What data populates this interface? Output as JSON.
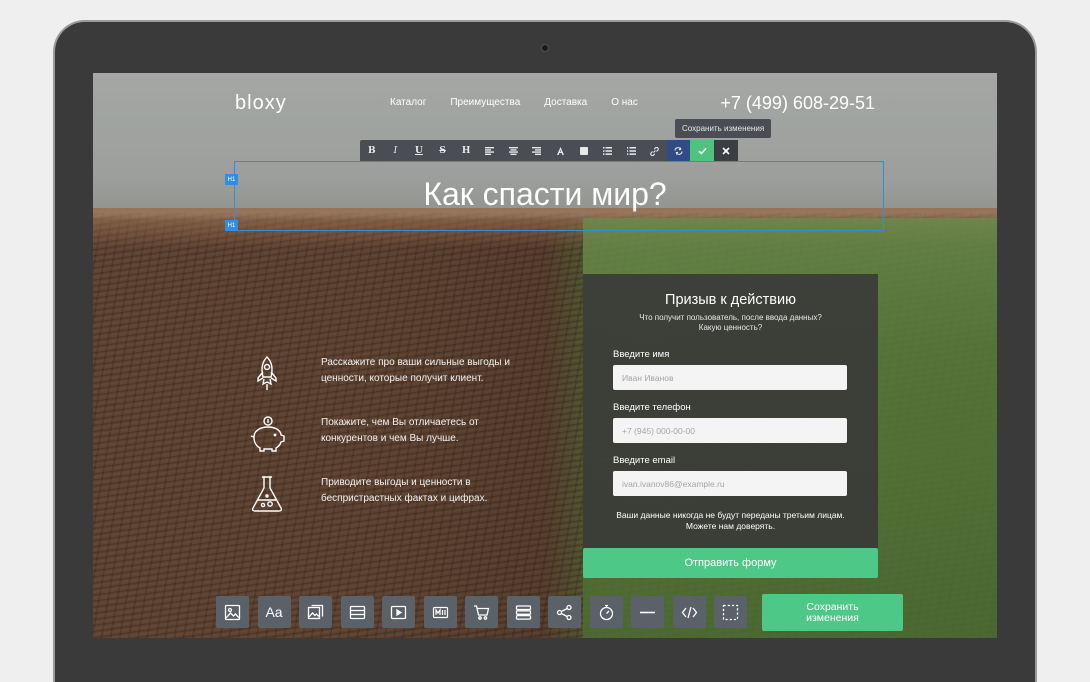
{
  "site": {
    "logo": "bloxy",
    "nav": [
      "Каталог",
      "Преимущества",
      "Доставка",
      "О нас"
    ],
    "phone": "+7 (499) 608-29-51"
  },
  "editor": {
    "tooltip": "Сохранить изменения",
    "toolbar_buttons": [
      {
        "label": "B",
        "icon": "bold-icon"
      },
      {
        "label": "I",
        "icon": "italic-icon"
      },
      {
        "label": "U",
        "icon": "underline-icon"
      },
      {
        "label": "S",
        "icon": "strikethrough-icon"
      },
      {
        "label": "H",
        "icon": "heading-icon"
      },
      {
        "label": "",
        "icon": "align-left-icon"
      },
      {
        "label": "",
        "icon": "align-center-icon"
      },
      {
        "label": "",
        "icon": "align-right-icon"
      },
      {
        "label": "",
        "icon": "text-color-icon"
      },
      {
        "label": "",
        "icon": "background-color-icon"
      },
      {
        "label": "",
        "icon": "bullet-list-icon"
      },
      {
        "label": "",
        "icon": "numbered-list-icon"
      },
      {
        "label": "",
        "icon": "link-icon"
      },
      {
        "label": "",
        "icon": "refresh-icon"
      },
      {
        "label": "",
        "icon": "check-icon"
      },
      {
        "label": "",
        "icon": "close-icon"
      }
    ],
    "heading_tag": "H1"
  },
  "hero": {
    "headline": "Как спасти мир?"
  },
  "benefits": [
    {
      "icon": "rocket-icon",
      "text": "Расскажите про ваши сильные выгоды и ценности, которые получит клиент."
    },
    {
      "icon": "piggy-bank-icon",
      "text": "Покажите, чем Вы отличаетесь от конкурентов и чем Вы лучше."
    },
    {
      "icon": "flask-icon",
      "text": "Приводите выгоды и ценности в беспристрастных фактах и цифрах."
    }
  ],
  "form": {
    "title": "Призыв к действию",
    "subtitle_line1": "Что получит пользователь, после ввода данных?",
    "subtitle_line2": "Какую ценность?",
    "name_label": "Введите имя",
    "name_placeholder": "Иван Иванов",
    "phone_label": "Введите телефон",
    "phone_placeholder": "+7 (945) 000-00-00",
    "email_label": "Введите email",
    "email_placeholder": "ivan.ivanov86@example.ru",
    "privacy_line1": "Ваши данные никогда не будут переданы третьим лицам.",
    "privacy_line2": "Можете нам доверять.",
    "submit": "Отправить форму"
  },
  "blocks_bar": {
    "items": [
      {
        "label": "",
        "icon": "image-icon"
      },
      {
        "label": "Aa",
        "icon": "text-icon"
      },
      {
        "label": "",
        "icon": "gallery-icon"
      },
      {
        "label": "",
        "icon": "layout-icon"
      },
      {
        "label": "",
        "icon": "video-icon"
      },
      {
        "label": "",
        "icon": "timer-icon"
      },
      {
        "label": "",
        "icon": "cart-icon"
      },
      {
        "label": "",
        "icon": "list-icon"
      },
      {
        "label": "",
        "icon": "share-icon"
      },
      {
        "label": "",
        "icon": "stopwatch-icon"
      },
      {
        "label": "",
        "icon": "divider-icon"
      },
      {
        "label": "",
        "icon": "code-icon"
      },
      {
        "label": "",
        "icon": "selection-icon"
      }
    ],
    "save_line1": "Сохранить",
    "save_line2": "изменения"
  }
}
